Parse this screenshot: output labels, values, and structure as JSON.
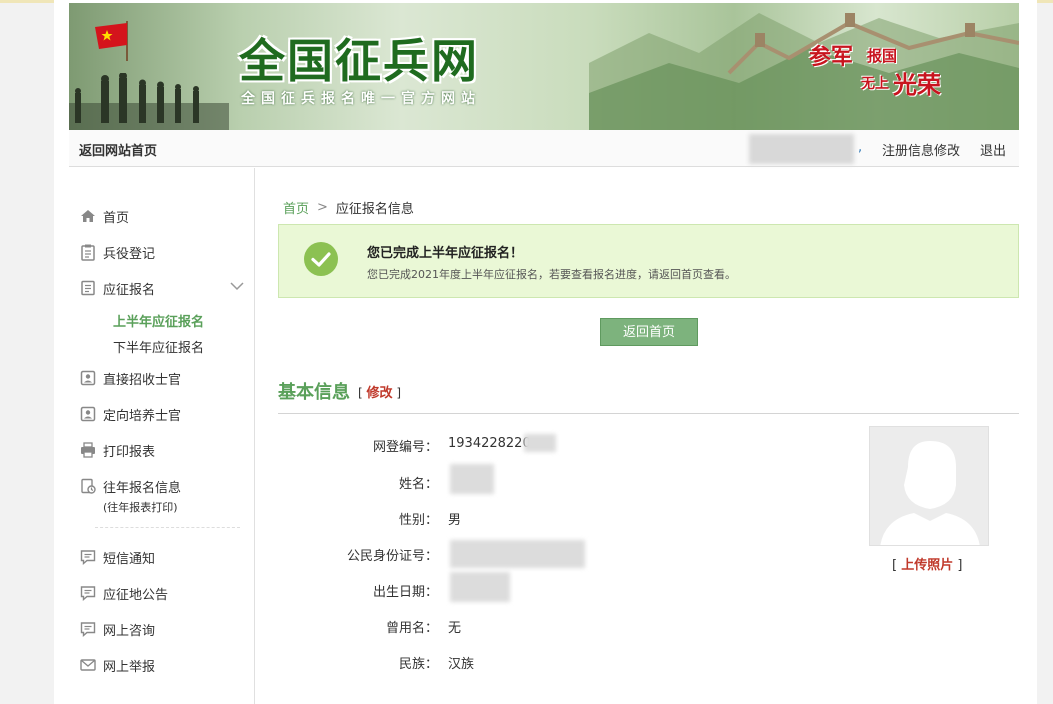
{
  "banner": {
    "title": "全国征兵网",
    "subtitle": "全国征兵报名唯一官方网站",
    "slogan_1": "参军",
    "slogan_2": "报国",
    "slogan_3": "无上",
    "slogan_4": "光荣"
  },
  "topnav": {
    "home": "返回网站首页",
    "comma": ",",
    "edit": "注册信息修改",
    "logout": "退出"
  },
  "sidebar": {
    "items": [
      {
        "label": "首页",
        "icon": "home-icon"
      },
      {
        "label": "兵役登记",
        "icon": "clipboard-icon"
      },
      {
        "label": "应征报名",
        "icon": "document-icon"
      },
      {
        "label": "直接招收士官",
        "icon": "id-card-icon"
      },
      {
        "label": "定向培养士官",
        "icon": "id-card-icon"
      },
      {
        "label": "打印报表",
        "icon": "printer-icon"
      },
      {
        "label": "往年报名信息",
        "icon": "history-icon"
      },
      {
        "label": "短信通知",
        "icon": "message-icon"
      },
      {
        "label": "应征地公告",
        "icon": "message-icon"
      },
      {
        "label": "网上咨询",
        "icon": "message-icon"
      },
      {
        "label": "网上举报",
        "icon": "mail-icon"
      }
    ],
    "sub_items": [
      "上半年应征报名",
      "下半年应征报名"
    ],
    "history_note": "(往年报表打印)"
  },
  "breadcrumb": {
    "home": "首页",
    "sep": ">",
    "current": "应征报名信息"
  },
  "notice": {
    "title": "您已完成上半年应征报名！",
    "desc": "您已完成2021年度上半年应征报名，若要查看报名进度，请返回首页查看。"
  },
  "back_button": "返回首页",
  "basic_info": {
    "title": "基本信息",
    "bracket_open": "[",
    "modify": "修改",
    "bracket_close": "]",
    "fields": [
      {
        "label": "网登编号：",
        "value": "1934228220"
      },
      {
        "label": "姓名：",
        "value": ""
      },
      {
        "label": "性别：",
        "value": "男"
      },
      {
        "label": "公民身份证号：",
        "value": ""
      },
      {
        "label": "出生日期：",
        "value": ""
      },
      {
        "label": "曾用名：",
        "value": "无"
      },
      {
        "label": "民族：",
        "value": "汉族"
      }
    ],
    "upload_open": "[",
    "upload": "上传照片",
    "upload_close": "]"
  },
  "colors": {
    "accent_green": "#5aa05a",
    "button_green": "#7db37d",
    "notice_bg": "#eaf8d6",
    "link_red": "#c0392b"
  }
}
